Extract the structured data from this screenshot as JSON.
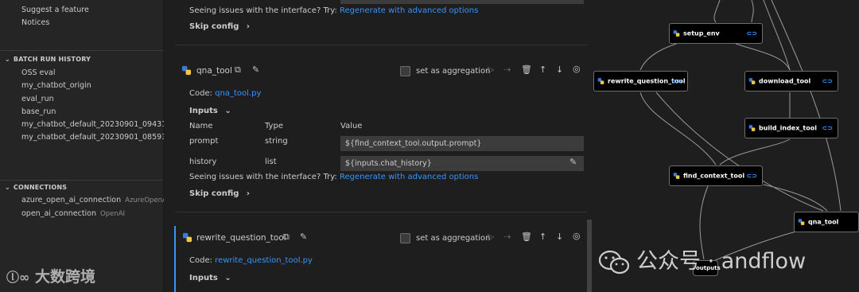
{
  "sidebar": {
    "top_items": [
      "Suggest a feature",
      "Notices"
    ],
    "batch_header": "BATCH RUN HISTORY",
    "batch_items": [
      "OSS eval",
      "my_chatbot_origin",
      "eval_run",
      "base_run",
      "my_chatbot_default_20230901_09431...",
      "my_chatbot_default_20230901_08593..."
    ],
    "connections_header": "CONNECTIONS",
    "connections": [
      {
        "name": "azure_open_ai_connection",
        "type": "AzureOpenAI"
      },
      {
        "name": "open_ai_connection",
        "type": "OpenAI"
      }
    ],
    "watermark": "大数跨境"
  },
  "editor": {
    "issues_text": "Seeing issues with the interface? Try:",
    "regenerate_link": "Regenerate with advanced options",
    "skip_config": "Skip config",
    "qna_tool": {
      "name": "qna_tool",
      "code_label": "Code:",
      "code_file": "qna_tool.py",
      "inputs_label": "Inputs",
      "aggregation_label": "set as aggregation",
      "headers": [
        "Name",
        "Type",
        "Value"
      ],
      "rows": [
        {
          "name": "prompt",
          "type": "string",
          "value": "${find_context_tool.output.prompt}"
        },
        {
          "name": "history",
          "type": "list",
          "value": "${inputs.chat_history}"
        }
      ]
    },
    "rewrite_tool": {
      "name": "rewrite_question_tool",
      "code_label": "Code:",
      "code_file": "rewrite_question_tool.py",
      "inputs_label": "Inputs",
      "aggregation_label": "set as aggregation"
    }
  },
  "graph": {
    "nodes": [
      "setup_env",
      "rewrite_question_tool",
      "download_tool",
      "build_index_tool",
      "find_context_tool",
      "qna_tool",
      "outputs"
    ],
    "watermark": "公众号 · andflow"
  }
}
